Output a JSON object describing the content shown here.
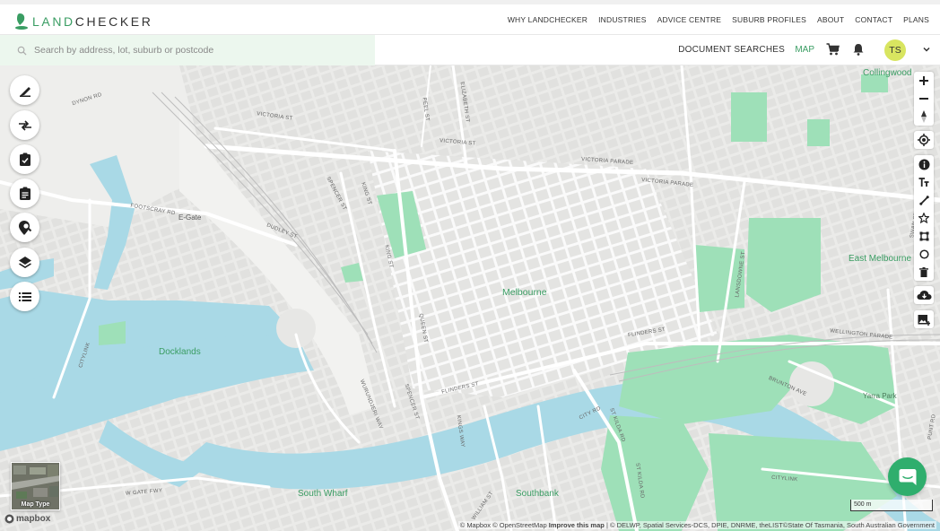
{
  "brand": {
    "name_a": "LAND",
    "name_b": "CHECKER"
  },
  "topnav": [
    "WHY LANDCHECKER",
    "INDUSTRIES",
    "ADVICE CENTRE",
    "SUBURB PROFILES",
    "ABOUT",
    "CONTACT",
    "PLANS"
  ],
  "search": {
    "placeholder": "Search by address, lot, suburb or postcode",
    "value": ""
  },
  "subnav": {
    "document_searches": "DOCUMENT SEARCHES",
    "map": "MAP",
    "avatar_initials": "TS"
  },
  "left_tools": [
    "ruler-pencil-icon",
    "compare-arrows-icon",
    "clipboard-check-icon",
    "document-icon",
    "location-search-icon",
    "layers-icon",
    "list-icon"
  ],
  "right_tools": [
    "zoom-in-icon",
    "zoom-out-icon",
    "compass-icon",
    "locate-icon",
    "info-icon",
    "text-icon",
    "line-icon",
    "star-icon",
    "polygon-icon",
    "circle-icon",
    "trash-icon",
    "cloud-download-icon",
    "add-image-icon"
  ],
  "map": {
    "places": [
      "Collingwood",
      "Melbourne",
      "East Melbourne",
      "Docklands",
      "Yarra Park",
      "South Wharf",
      "Southbank",
      "E-Gate"
    ],
    "roads": [
      "DYNON RD",
      "FOOTSCRAY RD",
      "DUDLEY ST",
      "VICTORIA ST",
      "VICTORIA ST",
      "VICTORIA PARADE",
      "VICTORIA PARADE",
      "PEEL ST",
      "ELIZABETH ST",
      "KING ST",
      "SPENCER ST",
      "KING ST",
      "WURUNDJERI WAY",
      "SPENCER ST",
      "FLINDERS ST",
      "FLINDERS ST",
      "QUEEN ST",
      "LANSDOWNE ST",
      "WELLINGTON PARADE",
      "BRUNTON AVE",
      "PUNT RD",
      "CITY RD",
      "KINGS WAY",
      "ST KILDA RD",
      "ST KILDA RD",
      "CITYLINK",
      "CITYLINK",
      "W GATE FWY",
      "SWAN ST",
      "WILLIAM ST"
    ],
    "map_type_label": "Map Type",
    "scale_label": "500 m",
    "mapbox_label": "mapbox",
    "attribution_a": "© Mapbox © OpenStreetMap",
    "attribution_improve": "Improve this map",
    "attribution_b": "| © DELWP, Spatial Services-DCS, DPIE, DNRME, theLIST©State Of Tasmania, South Australian Government"
  },
  "colors": {
    "brand_green": "#3a9d63",
    "park": "#9ee0b8",
    "water": "#a9d9e6",
    "avatar": "#d8e560",
    "chat": "#2fae6d"
  }
}
